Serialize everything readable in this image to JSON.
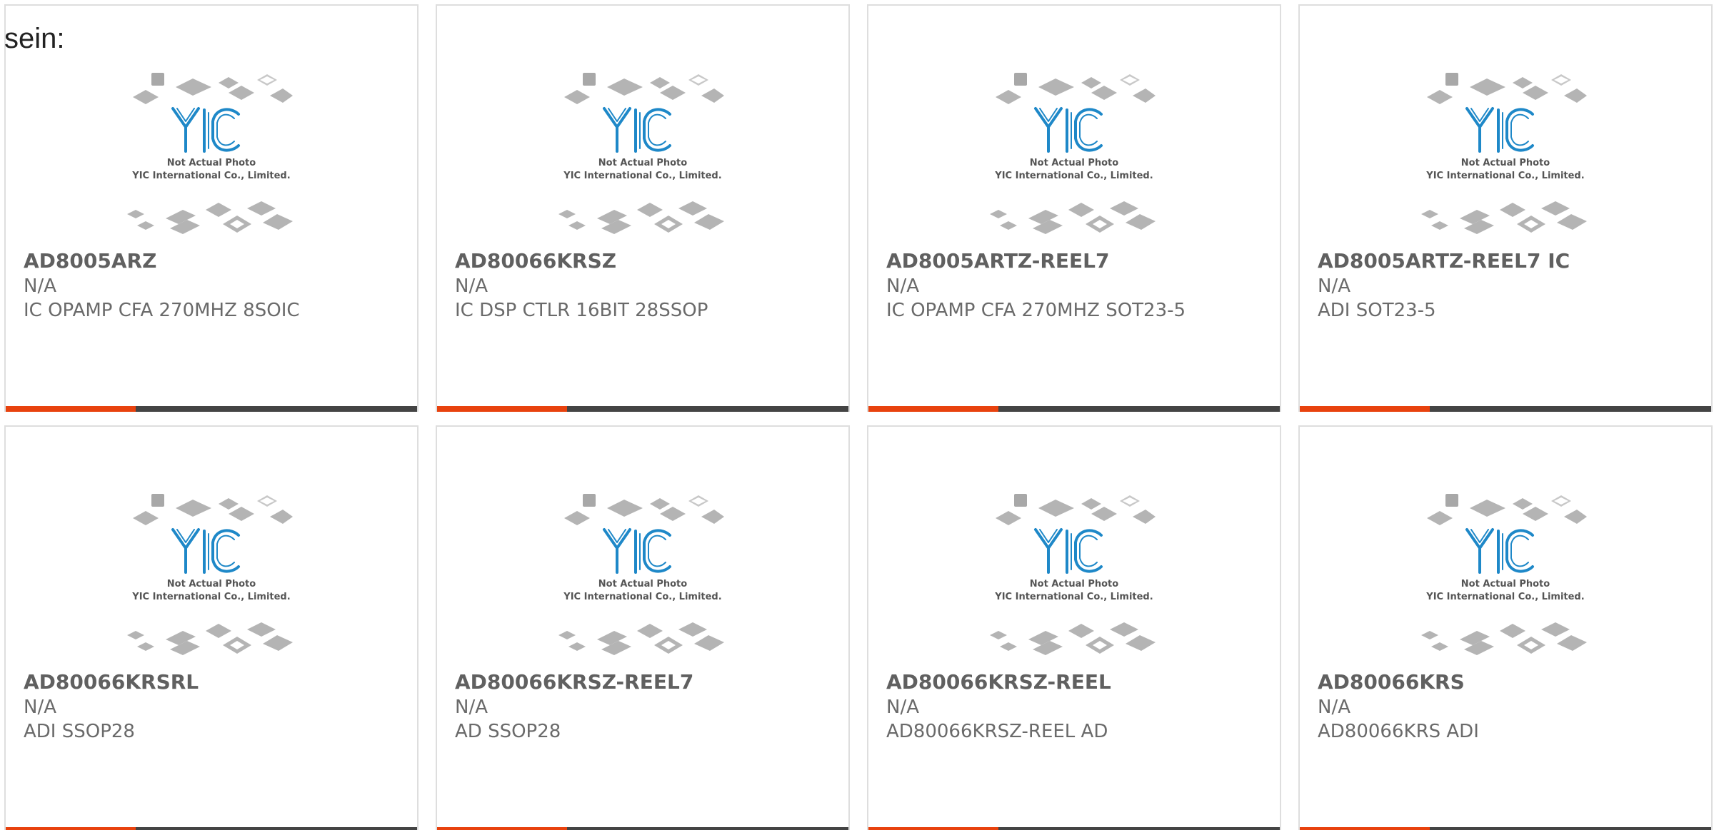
{
  "intro_text": "sein:",
  "placeholder": {
    "line1": "Not Actual Photo",
    "line2": "YIC International Co., Limited."
  },
  "colors": {
    "accent": "#e8420e",
    "bar": "#444444",
    "logo_blue": "#1e88c8",
    "chip_gray": "#b4b4b4"
  },
  "products": [
    {
      "title": "AD8005ARZ",
      "manufacturer": "N/A",
      "description": "IC OPAMP CFA 270MHZ 8SOIC"
    },
    {
      "title": "AD80066KRSZ",
      "manufacturer": "N/A",
      "description": "IC DSP CTLR 16BIT 28SSOP"
    },
    {
      "title": "AD8005ARTZ-REEL7",
      "manufacturer": "N/A",
      "description": "IC OPAMP CFA 270MHZ SOT23-5"
    },
    {
      "title": "AD8005ARTZ-REEL7 IC",
      "manufacturer": "N/A",
      "description": "ADI SOT23-5"
    },
    {
      "title": "AD80066KRSRL",
      "manufacturer": "N/A",
      "description": "ADI SSOP28"
    },
    {
      "title": "AD80066KRSZ-REEL7",
      "manufacturer": "N/A",
      "description": "AD SSOP28"
    },
    {
      "title": "AD80066KRSZ-REEL",
      "manufacturer": "N/A",
      "description": "AD80066KRSZ-REEL AD"
    },
    {
      "title": "AD80066KRS",
      "manufacturer": "N/A",
      "description": "AD80066KRS ADI"
    }
  ]
}
